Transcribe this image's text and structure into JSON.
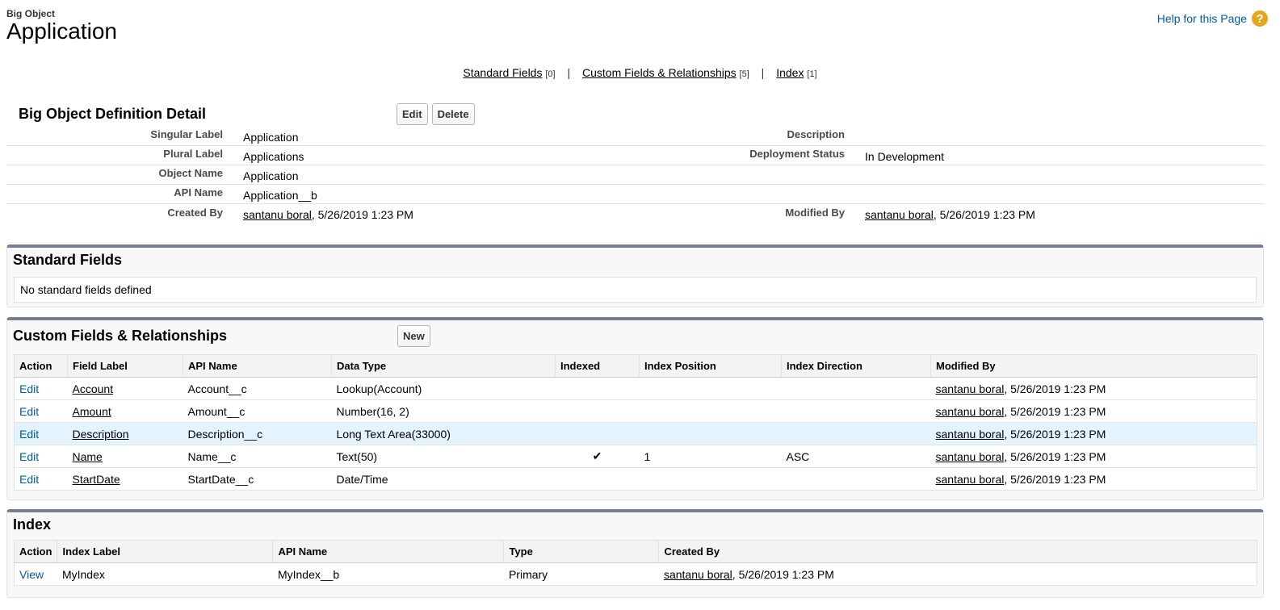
{
  "header": {
    "type": "Big Object",
    "title": "Application",
    "help_link": "Help for this Page",
    "help_icon": "?"
  },
  "related_nav": [
    {
      "label": "Standard Fields",
      "count": "[0]"
    },
    {
      "label": "Custom Fields & Relationships",
      "count": "[5]"
    },
    {
      "label": "Index",
      "count": "[1]"
    }
  ],
  "nav_sep": "|",
  "detail": {
    "title": "Big Object Definition Detail",
    "edit_button": "Edit",
    "delete_button": "Delete",
    "singular_label": {
      "label": "Singular Label",
      "value": "Application"
    },
    "plural_label": {
      "label": "Plural Label",
      "value": "Applications"
    },
    "object_name": {
      "label": "Object Name",
      "value": "Application"
    },
    "api_name": {
      "label": "API Name",
      "value": "Application__b"
    },
    "created_by": {
      "label": "Created By",
      "user": "santanu boral",
      "date": ", 5/26/2019 1:23 PM"
    },
    "description": {
      "label": "Description",
      "value": ""
    },
    "deployment_status": {
      "label": "Deployment Status",
      "value": "In Development"
    },
    "modified_by": {
      "label": "Modified By",
      "user": "santanu boral",
      "date": ", 5/26/2019 1:23 PM"
    }
  },
  "standard_fields": {
    "title": "Standard Fields",
    "empty_text": "No standard fields defined"
  },
  "custom_fields": {
    "title": "Custom Fields & Relationships",
    "new_button": "New",
    "columns": [
      "Action",
      "Field Label",
      "API Name",
      "Data Type",
      "Indexed",
      "Index Position",
      "Index Direction",
      "Modified By"
    ],
    "rows": [
      {
        "action": "Edit",
        "label": "Account",
        "api": "Account__c",
        "type": "Lookup(Account)",
        "indexed": "",
        "pos": "",
        "dir": "",
        "user": "santanu boral",
        "date": ", 5/26/2019 1:23 PM"
      },
      {
        "action": "Edit",
        "label": "Amount",
        "api": "Amount__c",
        "type": "Number(16, 2)",
        "indexed": "",
        "pos": "",
        "dir": "",
        "user": "santanu boral",
        "date": ", 5/26/2019 1:23 PM"
      },
      {
        "action": "Edit",
        "label": "Description",
        "api": "Description__c",
        "type": "Long Text Area(33000)",
        "indexed": "",
        "pos": "",
        "dir": "",
        "user": "santanu boral",
        "date": ", 5/26/2019 1:23 PM"
      },
      {
        "action": "Edit",
        "label": "Name",
        "api": "Name__c",
        "type": "Text(50)",
        "indexed": "✔",
        "pos": "1",
        "dir": "ASC",
        "user": "santanu boral",
        "date": ", 5/26/2019 1:23 PM"
      },
      {
        "action": "Edit",
        "label": "StartDate",
        "api": "StartDate__c",
        "type": "Date/Time",
        "indexed": "",
        "pos": "",
        "dir": "",
        "user": "santanu boral",
        "date": ", 5/26/2019 1:23 PM"
      }
    ],
    "highlighted_row": 2
  },
  "index": {
    "title": "Index",
    "columns": [
      "Action",
      "Index Label",
      "API Name",
      "Type",
      "Created By"
    ],
    "rows": [
      {
        "action": "View",
        "label": "MyIndex",
        "api": "MyIndex__b",
        "type": "Primary",
        "user": "santanu boral",
        "date": ", 5/26/2019 1:23 PM"
      }
    ]
  },
  "colors": {
    "link_blue": "#015ba7",
    "section_border": "#747e96",
    "help_icon": "#e4a81c",
    "row_highlight": "#e3f3ff"
  }
}
